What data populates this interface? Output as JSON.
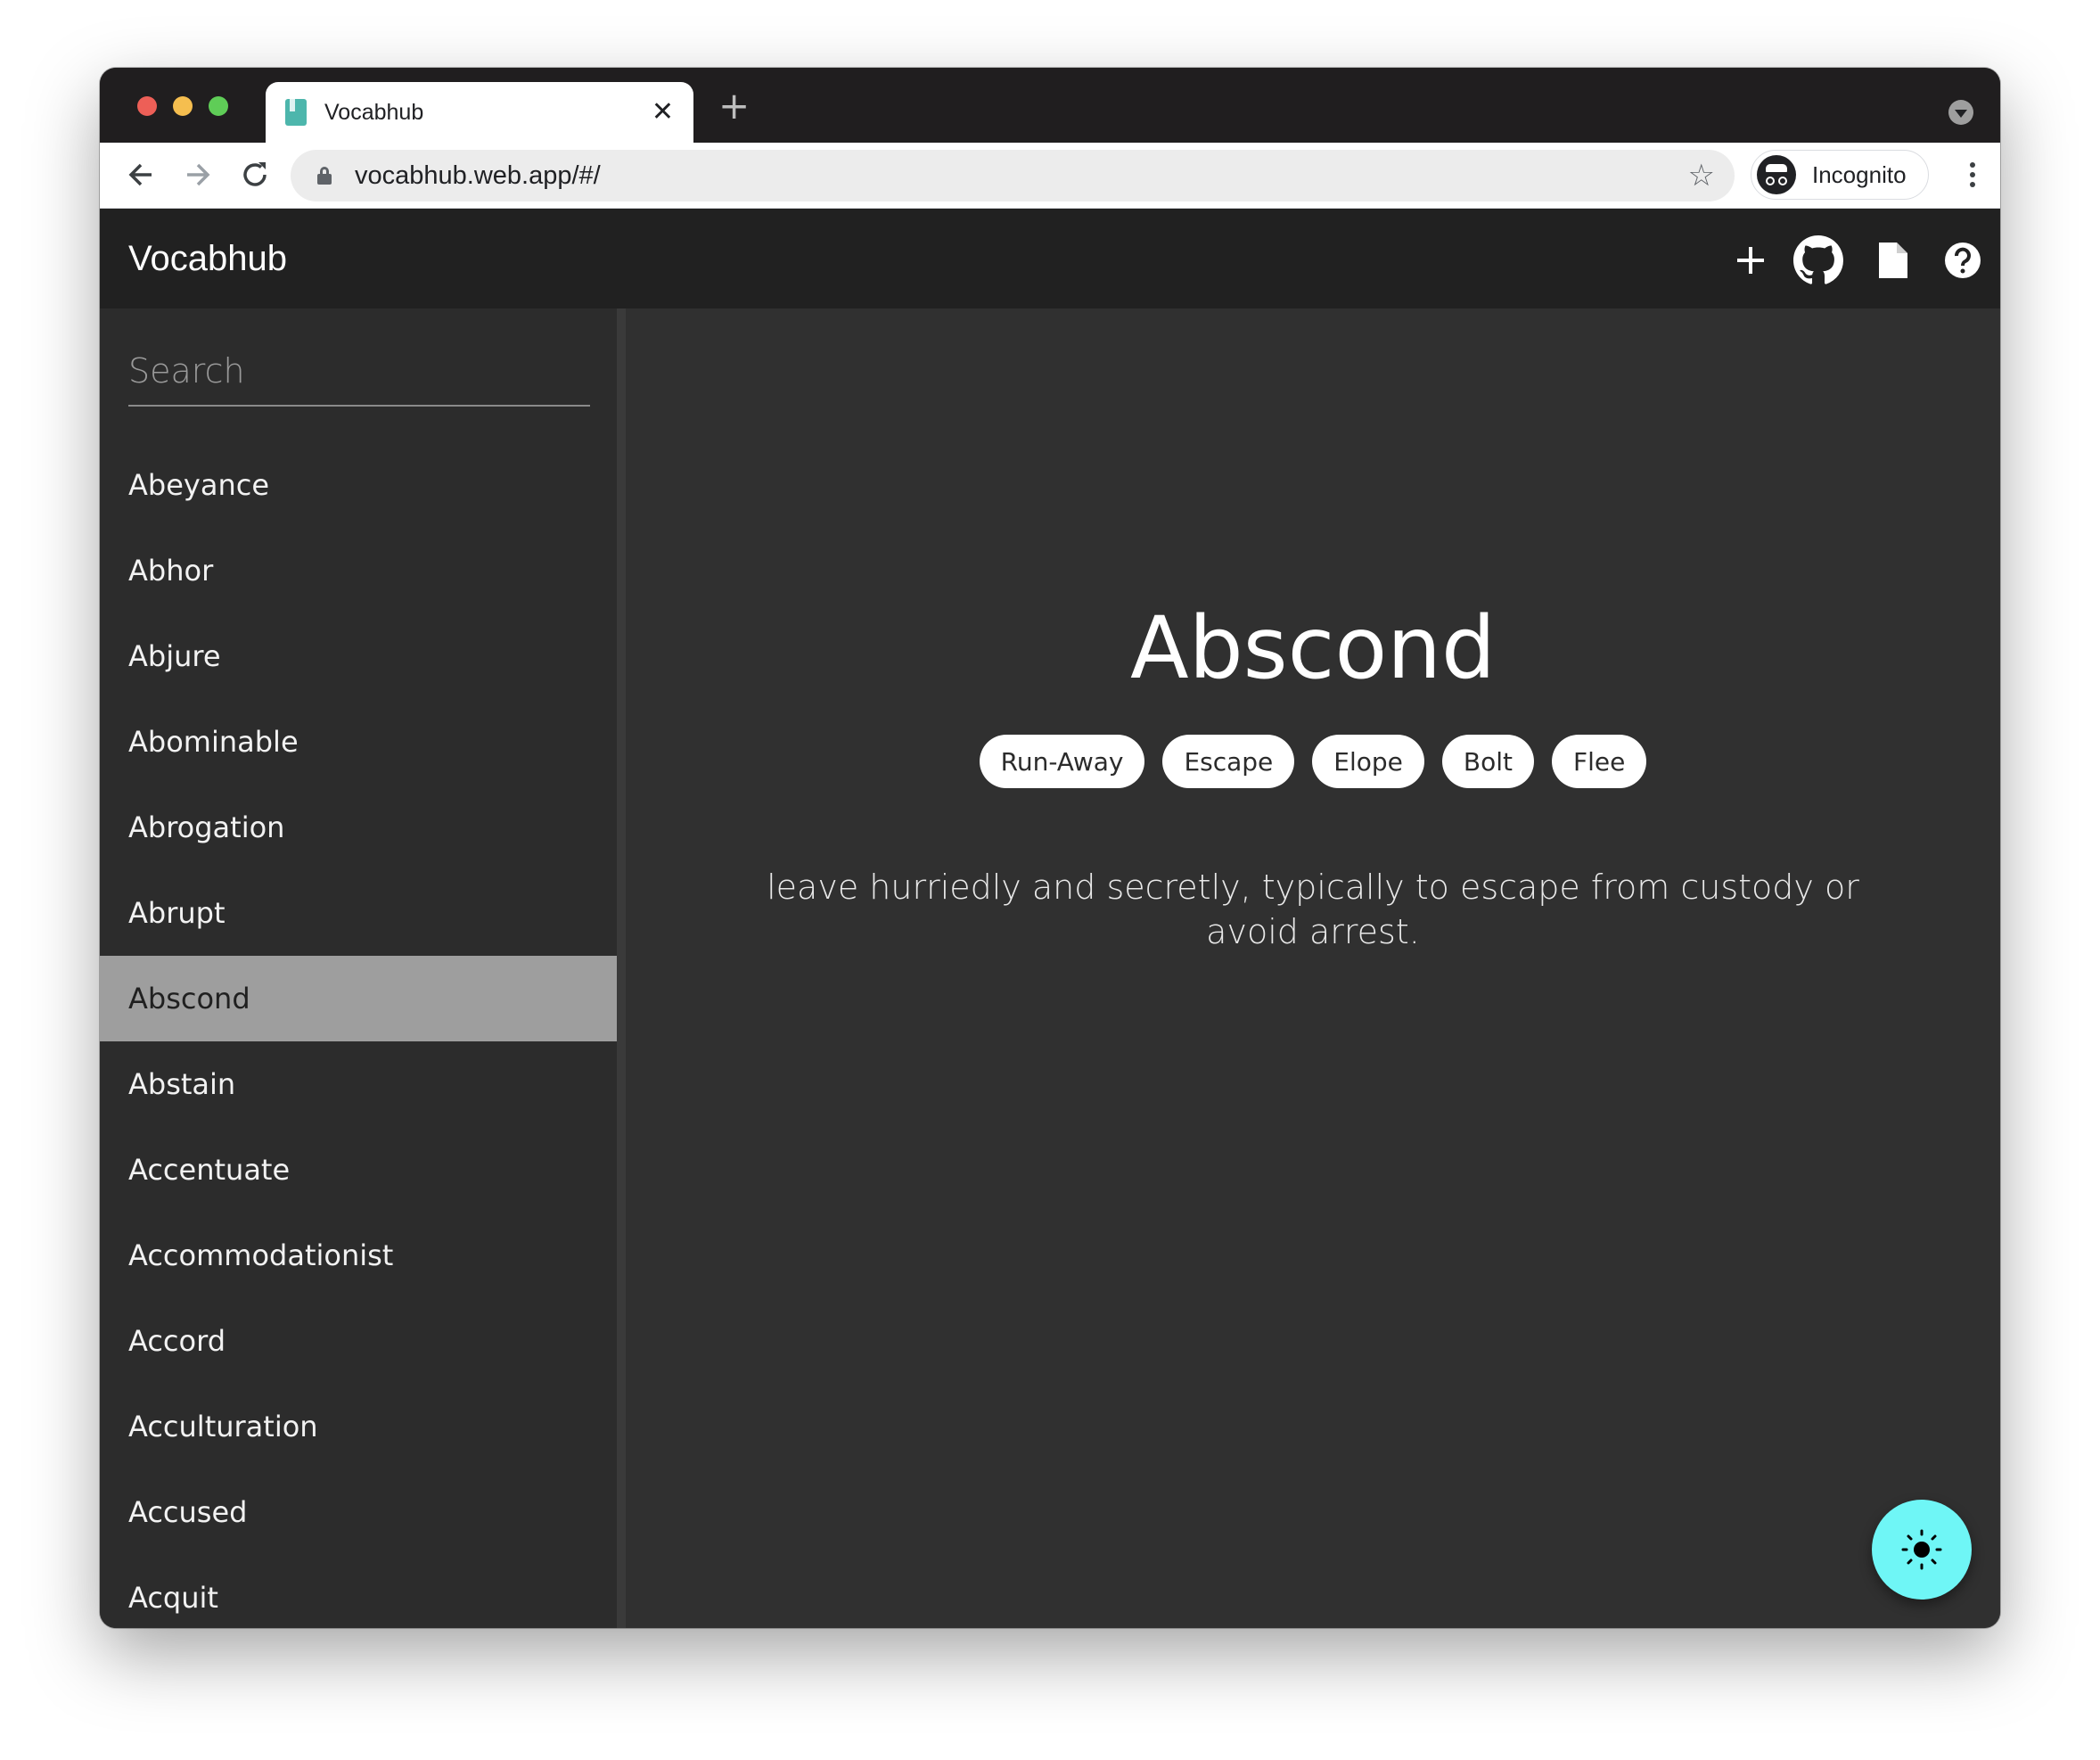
{
  "browser": {
    "tab_title": "Vocabhub",
    "tab_close": "✕",
    "new_tab": "+",
    "url": "vocabhub.web.app/#/",
    "profile_label": "Incognito"
  },
  "app": {
    "title": "Vocabhub",
    "search": {
      "placeholder": "Search",
      "value": ""
    },
    "words": [
      "Abeyance",
      "Abhor",
      "Abjure",
      "Abominable",
      "Abrogation",
      "Abrupt",
      "Abscond",
      "Abstain",
      "Accentuate",
      "Accommodationist",
      "Accord",
      "Acculturation",
      "Accused",
      "Acquit"
    ],
    "selected_index": 6,
    "detail": {
      "word": "Abscond",
      "synonyms": [
        "Run-Away",
        "Escape",
        "Elope",
        "Bolt",
        "Flee"
      ],
      "definition": "leave hurriedly and secretly, typically to escape from custody or avoid arrest."
    },
    "colors": {
      "fab": "#6ff6f6",
      "header": "#212121",
      "sidebar": "#2c2c2c",
      "main": "#303030",
      "selected_item": "#9e9e9e"
    },
    "icons": [
      "add-icon",
      "github-icon",
      "document-icon",
      "help-icon",
      "sun-icon"
    ]
  }
}
